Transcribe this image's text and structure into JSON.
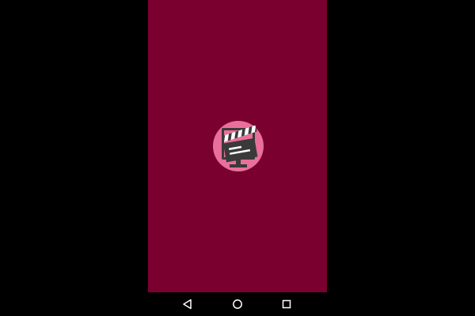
{
  "screen": {
    "background_color": "#7a0030"
  },
  "logo": {
    "icon": "clapperboard-tv-icon",
    "circle_color": "#e8709a",
    "board_color": "#3a3a3a",
    "stripe_color": "#ffffff"
  },
  "navigation_bar": {
    "background_color": "#000000",
    "icon_color": "#ffffff",
    "buttons": [
      {
        "icon": "back-triangle-icon"
      },
      {
        "icon": "home-circle-icon"
      },
      {
        "icon": "recents-square-icon"
      }
    ]
  }
}
